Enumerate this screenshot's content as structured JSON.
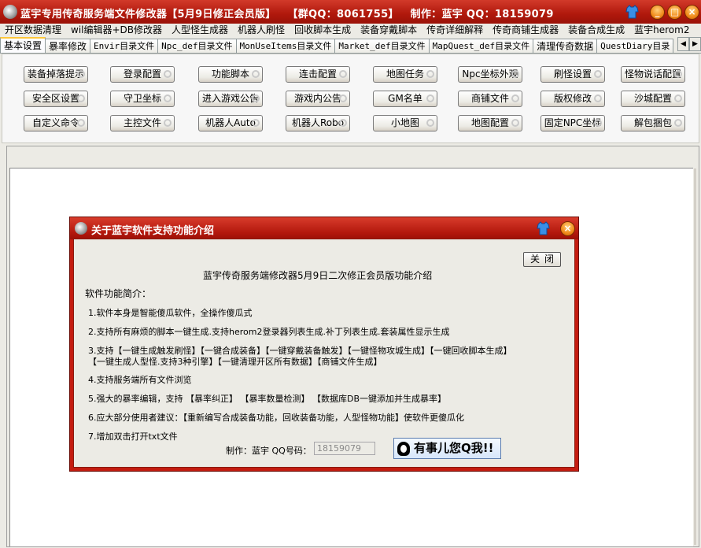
{
  "title": {
    "app_name": "蓝宇专用传奇服务端文件修改器【5月9日修正会员版】",
    "group": "【群QQ：8061755】",
    "author": "制作：蓝宇 QQ：18159079"
  },
  "window_buttons": {
    "minimize": "_",
    "maximize": "□",
    "close": "×"
  },
  "menu": [
    "开区数据清理",
    "wil编辑器+DB修改器",
    "人型怪生成器",
    "机器人刷怪",
    "回收脚本生成",
    "装备穿戴脚本",
    "传奇详细解释",
    "传奇商铺生成器",
    "装备合成生成",
    "蓝宇herom2"
  ],
  "tabs": [
    "基本设置",
    "暴率修改",
    "Envir目录文件",
    "Npc_def目录文件",
    "MonUseItems目录文件",
    "Market_def目录文件",
    "MapQuest_def目录文件",
    "清理传奇数据",
    "QuestDiary目录"
  ],
  "tab_scroll": {
    "left": "◀",
    "right": "▶"
  },
  "buttons": [
    [
      "装备掉落提示",
      "登录配置",
      "功能脚本",
      "连击配置",
      "地图任务",
      "Npc坐标外观",
      "刷怪设置",
      "怪物说话配置"
    ],
    [
      "安全区设置",
      "守卫坐标",
      "进入游戏公告",
      "游戏内公告",
      "GM名单",
      "商铺文件",
      "版权修改",
      "沙城配置"
    ],
    [
      "自定义命令",
      "主控文件",
      "机器人Auto",
      "机器人Robo",
      "小地图",
      "地图配置",
      "固定NPC坐标",
      "解包捆包"
    ]
  ],
  "dialog": {
    "title": "关于蓝宇软件支持功能介绍",
    "close_label": "关闭",
    "heading": "蓝宇传奇服务端修改器5月9日二次修正会员版功能介绍",
    "intro": "软件功能简介：",
    "lines": [
      "1.软件本身是智能傻瓜软件，全操作傻瓜式",
      "2.支持所有麻烦的脚本一键生成.支持herom2登录器列表生成.补丁列表生成.套装属性显示生成",
      "3.支持【一键生成触发刷怪】【一键合成装备】【一键穿戴装备触发】【一键怪物攻城生成】【一键回收脚本生成】",
      "【一键生成人型怪.支持3种引擎】【一键清理开区所有数据】【商铺文件生成】",
      "4.支持服务端所有文件浏览",
      "5.强大的暴率编辑，支持 【暴率纠正】 【暴率数量检测】 【数据库DB一键添加并生成暴率】",
      "6.应大部分使用者建议：【重新编写合成装备功能，回收装备功能，人型怪物功能】使软件更傻瓜化",
      "7.增加双击打开txt文件"
    ],
    "qq_label": "制作：蓝宇 QQ号码：",
    "qq_value": "18159079",
    "qq_button": "有事儿您Q我!!"
  }
}
